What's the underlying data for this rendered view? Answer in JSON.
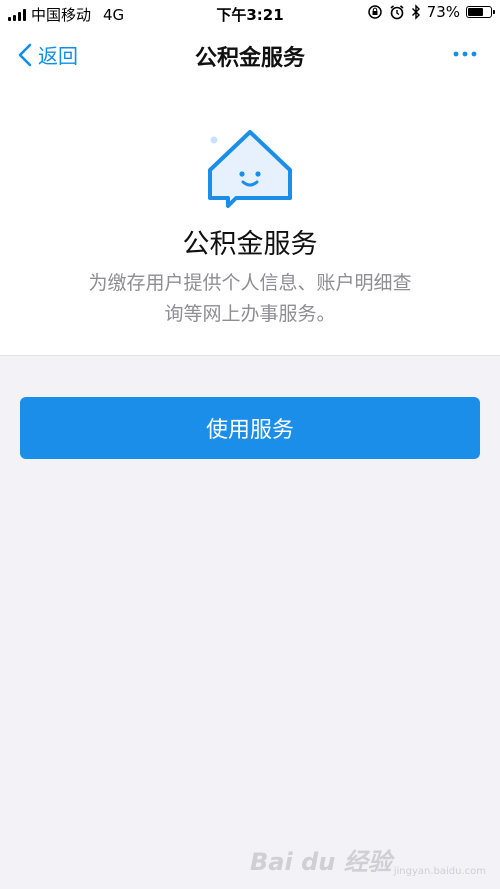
{
  "status_bar": {
    "carrier": "中国移动",
    "network": "4G",
    "time": "下午3:21",
    "battery_percent": "73%",
    "battery_level": 0.73,
    "icons": [
      "signal-icon",
      "lock-rotation-icon",
      "alarm-icon",
      "bluetooth-icon",
      "battery-icon"
    ]
  },
  "nav": {
    "back_label": "返回",
    "title": "公积金服务",
    "more_icon": "more-icon"
  },
  "hero": {
    "icon": "house-smile-icon",
    "title": "公积金服务",
    "description": "为缴存用户提供个人信息、账户明细查询等网上办事服务。"
  },
  "actions": {
    "use_service_label": "使用服务"
  },
  "colors": {
    "accent": "#1a8ee9",
    "background": "#f2f2f7",
    "text_secondary": "#8e8e93"
  },
  "watermark": {
    "main": "Bai du 经验",
    "sub": "jingyan.baidu.com"
  }
}
